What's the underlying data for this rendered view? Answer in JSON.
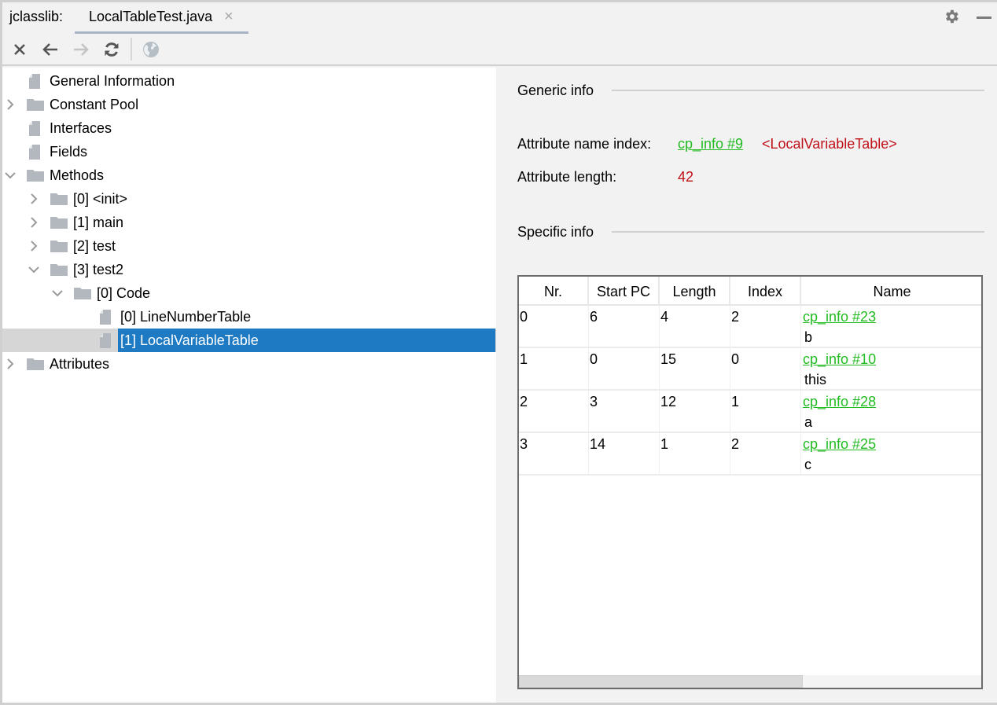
{
  "window": {
    "app_label": "jclasslib:",
    "tab": {
      "label": "LocalTableTest.java",
      "close_glyph": "×"
    },
    "icons": {
      "settings": "gear-icon",
      "minimize": "minimize-icon"
    }
  },
  "toolbar": {
    "buttons": [
      {
        "name": "close",
        "icon": "close-icon",
        "enabled": true
      },
      {
        "name": "back",
        "icon": "arrow-left-icon",
        "enabled": true
      },
      {
        "name": "forward",
        "icon": "arrow-right-icon",
        "enabled": false
      },
      {
        "name": "reload",
        "icon": "refresh-icon",
        "enabled": true
      },
      {
        "name": "browser",
        "icon": "globe-icon",
        "enabled": false
      }
    ]
  },
  "tree": {
    "items": [
      {
        "label": "General Information",
        "icon": "file-icon",
        "level": 0,
        "expander": "none"
      },
      {
        "label": "Constant Pool",
        "icon": "folder-icon",
        "level": 0,
        "expander": "collapsed"
      },
      {
        "label": "Interfaces",
        "icon": "file-icon",
        "level": 0,
        "expander": "none"
      },
      {
        "label": "Fields",
        "icon": "file-icon",
        "level": 0,
        "expander": "none"
      },
      {
        "label": "Methods",
        "icon": "folder-icon",
        "level": 0,
        "expander": "expanded"
      },
      {
        "label": "[0] <init>",
        "icon": "folder-icon",
        "level": 1,
        "expander": "collapsed"
      },
      {
        "label": "[1] main",
        "icon": "folder-icon",
        "level": 1,
        "expander": "collapsed"
      },
      {
        "label": "[2] test",
        "icon": "folder-icon",
        "level": 1,
        "expander": "collapsed"
      },
      {
        "label": "[3] test2",
        "icon": "folder-icon",
        "level": 1,
        "expander": "expanded"
      },
      {
        "label": "[0] Code",
        "icon": "folder-icon",
        "level": 2,
        "expander": "expanded"
      },
      {
        "label": "[0] LineNumberTable",
        "icon": "file-icon",
        "level": 3,
        "expander": "none"
      },
      {
        "label": "[1] LocalVariableTable",
        "icon": "file-icon",
        "level": 3,
        "expander": "none",
        "selected": true
      },
      {
        "label": "Attributes",
        "icon": "folder-icon",
        "level": 0,
        "expander": "collapsed"
      }
    ],
    "selection_color": "#1e7ac3"
  },
  "generic_info": {
    "title": "Generic info",
    "name_index_label": "Attribute name index:",
    "name_index_link": "cp_info #9",
    "name_index_value": "<LocalVariableTable>",
    "length_label": "Attribute length:",
    "length_value": "42"
  },
  "specific_info": {
    "title": "Specific info",
    "table": {
      "columns": [
        "Nr.",
        "Start PC",
        "Length",
        "Index",
        "Name"
      ],
      "rows": [
        {
          "nr": "0",
          "start_pc": "6",
          "length": "4",
          "index": "2",
          "name_link": "cp_info #23",
          "name_value": "b"
        },
        {
          "nr": "1",
          "start_pc": "0",
          "length": "15",
          "index": "0",
          "name_link": "cp_info #10",
          "name_value": "this"
        },
        {
          "nr": "2",
          "start_pc": "3",
          "length": "12",
          "index": "1",
          "name_link": "cp_info #28",
          "name_value": "a"
        },
        {
          "nr": "3",
          "start_pc": "14",
          "length": "1",
          "index": "2",
          "name_link": "cp_info #25",
          "name_value": "c"
        }
      ]
    }
  },
  "colors": {
    "link": "#22bb22",
    "value_red": "#c0101a",
    "selection": "#1e7ac3"
  }
}
